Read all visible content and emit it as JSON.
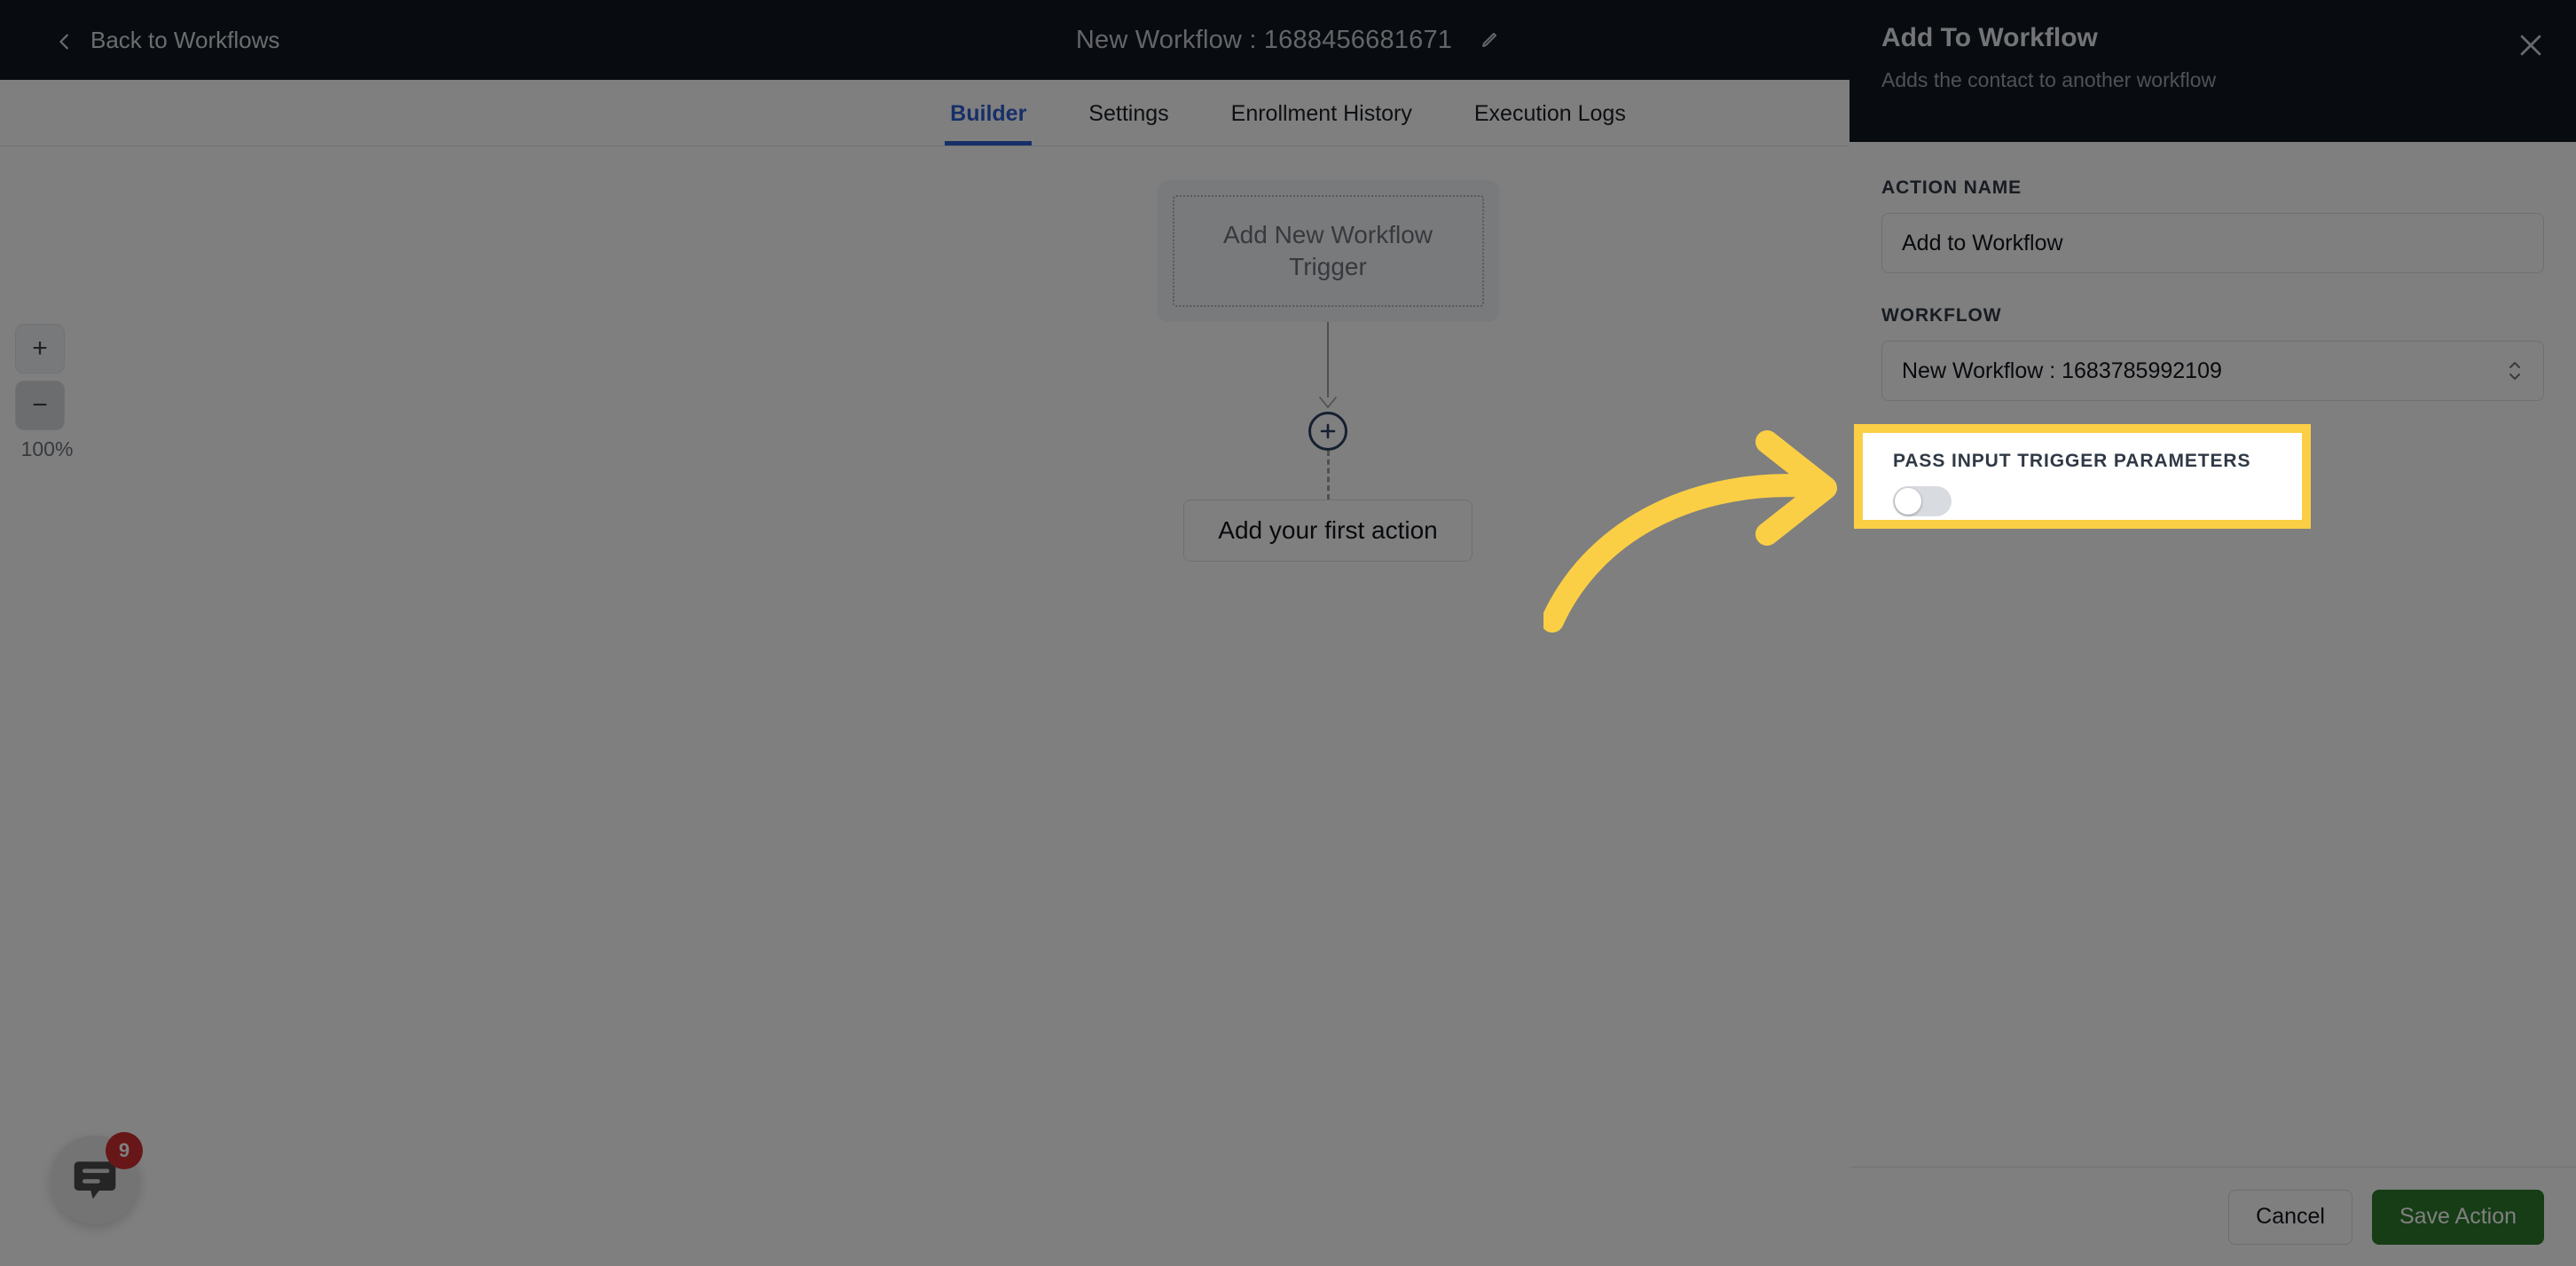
{
  "topbar": {
    "back_label": "Back to Workflows",
    "back_icon": "chevron-left-icon",
    "title": "New Workflow : 1688456681671",
    "edit_icon": "pencil-icon",
    "background": "#111821"
  },
  "tabs": [
    {
      "label": "Builder",
      "active": true
    },
    {
      "label": "Settings",
      "active": false
    },
    {
      "label": "Enrollment History",
      "active": false
    },
    {
      "label": "Execution Logs",
      "active": false
    }
  ],
  "tab_accent": "#2f5fd0",
  "canvas": {
    "zoom": {
      "zoom_in_label": "+",
      "zoom_out_label": "−",
      "level": "100%"
    },
    "trigger_card_label": "Add New Workflow Trigger",
    "add_node_icon": "plus-circle-icon",
    "add_node_label": "+",
    "first_action_label": "Add your first action"
  },
  "chat_widget": {
    "icon": "chat-bubble-icon",
    "badge_count": "9",
    "badge_color": "#cf2e2e"
  },
  "panel": {
    "title": "Add To Workflow",
    "subtitle": "Adds the contact to another workflow",
    "close_icon": "close-icon",
    "fields": {
      "action_name": {
        "label": "ACTION NAME",
        "value": "Add to Workflow",
        "placeholder": "Action Name"
      },
      "workflow": {
        "label": "WORKFLOW",
        "value": "New Workflow : 1683785992109",
        "chevron_icon": "chevron-updown-icon"
      },
      "pass_input_trigger_parameters": {
        "label": "PASS INPUT TRIGGER PARAMETERS",
        "toggle_state": "off"
      }
    },
    "footer": {
      "cancel_label": "Cancel",
      "save_label": "Save Action",
      "save_color": "#2d7a2d"
    }
  },
  "annotation": {
    "highlight_color": "#FBCF45",
    "arrow_icon": "curved-arrow-right-icon"
  }
}
